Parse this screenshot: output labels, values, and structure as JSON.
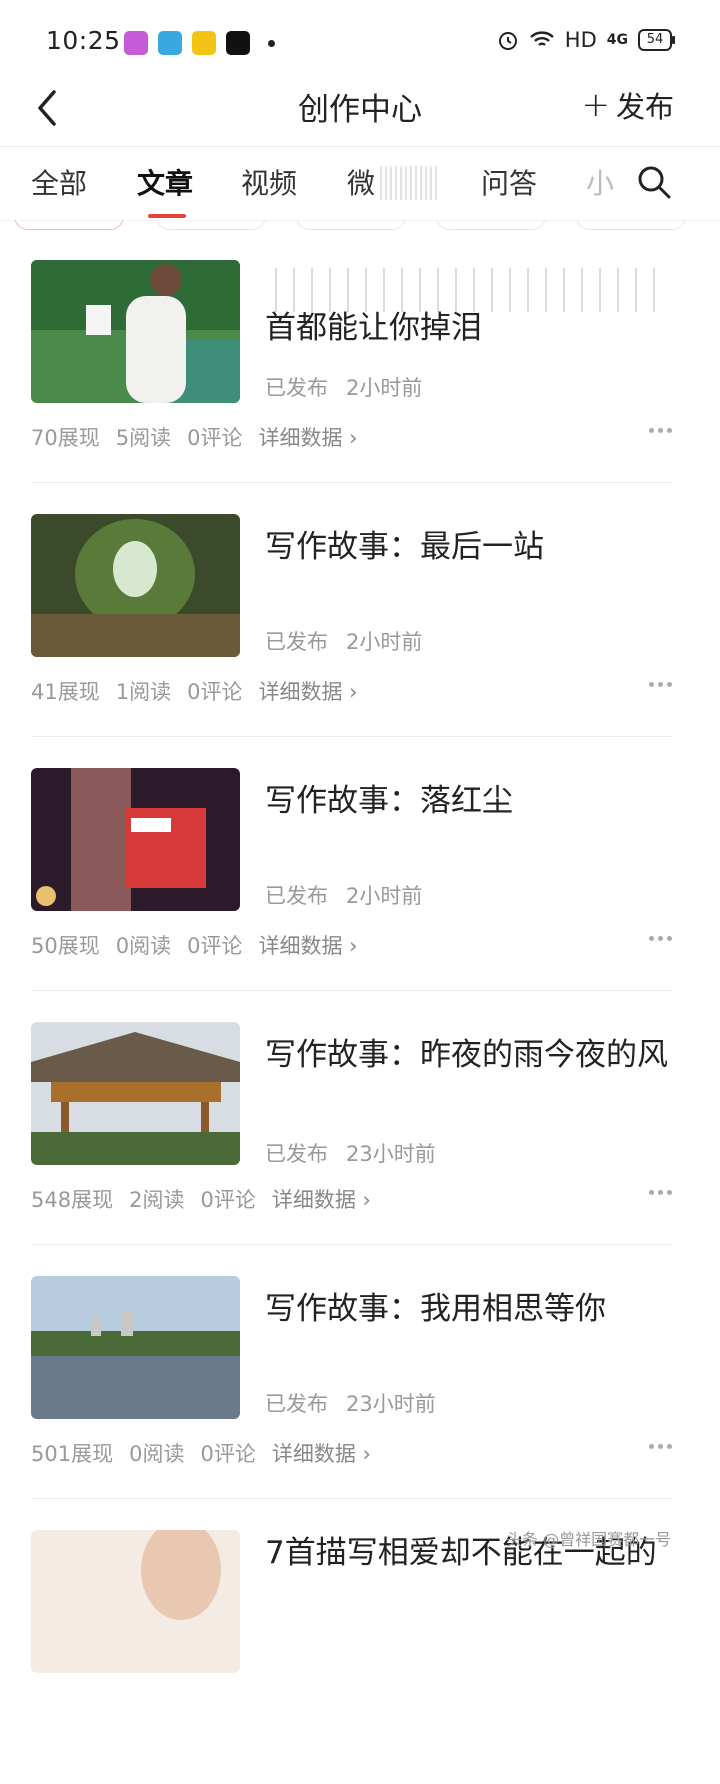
{
  "status_bar": {
    "time": "10:25",
    "network": "HD",
    "signal": "4G",
    "battery": "54"
  },
  "header": {
    "title": "创作中心",
    "publish_label": "发布"
  },
  "tabs": [
    "全部",
    "文章",
    "视频",
    "微",
    "问答",
    "小"
  ],
  "articles": [
    {
      "title": "首都能让你掉泪",
      "status": "已发布",
      "time": "2小时前",
      "views": "70展现",
      "reads": "5阅读",
      "comments": "0评论",
      "detail": "详细数据"
    },
    {
      "title": "写作故事：最后一站",
      "status": "已发布",
      "time": "2小时前",
      "views": "41展现",
      "reads": "1阅读",
      "comments": "0评论",
      "detail": "详细数据"
    },
    {
      "title": "写作故事：落红尘",
      "status": "已发布",
      "time": "2小时前",
      "views": "50展现",
      "reads": "0阅读",
      "comments": "0评论",
      "detail": "详细数据"
    },
    {
      "title": "写作故事：昨夜的雨今夜的风",
      "status": "已发布",
      "time": "23小时前",
      "views": "548展现",
      "reads": "2阅读",
      "comments": "0评论",
      "detail": "详细数据"
    },
    {
      "title": "写作故事：我用相思等你",
      "status": "已发布",
      "time": "23小时前",
      "views": "501展现",
      "reads": "0阅读",
      "comments": "0评论",
      "detail": "详细数据"
    },
    {
      "title": "7首描写相爱却不能在一起的"
    }
  ],
  "watermark": "头条 @曾祥国赛都一号",
  "colors": {
    "accent": "#e8413a",
    "muted": "#999999"
  }
}
